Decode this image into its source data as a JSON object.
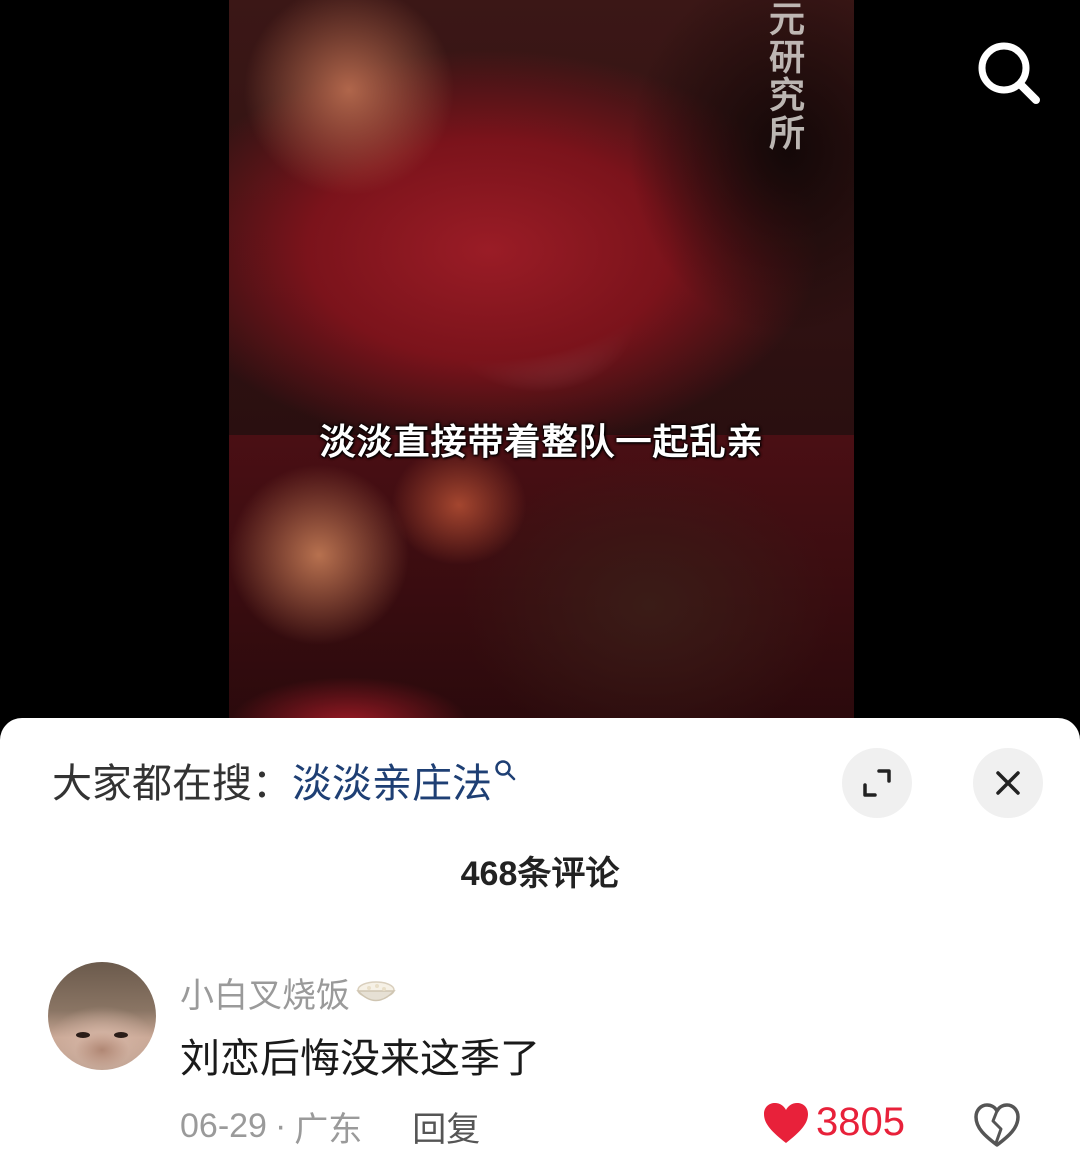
{
  "video": {
    "watermark": "元研究所",
    "subtitle": "淡淡直接带着整队一起乱亲",
    "search_icon": "search-icon"
  },
  "hot_search": {
    "prefix": "大家都在搜：",
    "term": "淡淡亲庄法"
  },
  "header": {
    "expand_icon": "expand-icon",
    "close_icon": "close-icon"
  },
  "comments_header": {
    "count_label": "468条评论"
  },
  "comments": [
    {
      "username": "小白叉烧饭",
      "badge_icon": "rice-bowl-icon",
      "text": "刘恋后悔没来这季了",
      "date": "06-29",
      "separator": "·",
      "location": "广东",
      "reply_label": "回复",
      "likes": "3805"
    }
  ],
  "colors": {
    "like": "#e8213a",
    "search_term": "#1e3f74",
    "muted_text": "#9a9a9a"
  }
}
